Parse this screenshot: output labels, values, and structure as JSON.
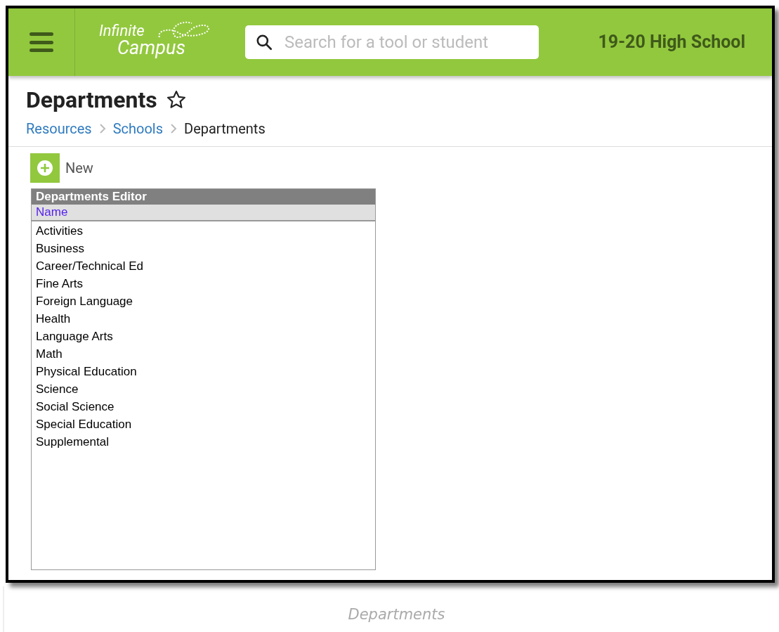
{
  "header": {
    "logo": {
      "line_1": "Infinite",
      "line_2": "Campus"
    },
    "search": {
      "placeholder": "Search for a tool or student"
    },
    "school": "19-20 High School"
  },
  "page": {
    "title": "Departments",
    "favorite": false,
    "breadcrumbs": [
      {
        "label": "Resources",
        "link": true
      },
      {
        "label": "Schools",
        "link": true
      },
      {
        "label": "Departments",
        "link": false
      }
    ]
  },
  "toolbar": {
    "new_button": "New"
  },
  "editor": {
    "title": "Departments Editor",
    "column": "Name",
    "rows": [
      "Activities",
      "Business",
      "Career/Technical Ed",
      "Fine Arts",
      "Foreign Language",
      "Health",
      "Language Arts",
      "Math",
      "Physical Education",
      "Science",
      "Social Science",
      "Special Education",
      "Supplemental"
    ]
  },
  "caption": "Departments"
}
